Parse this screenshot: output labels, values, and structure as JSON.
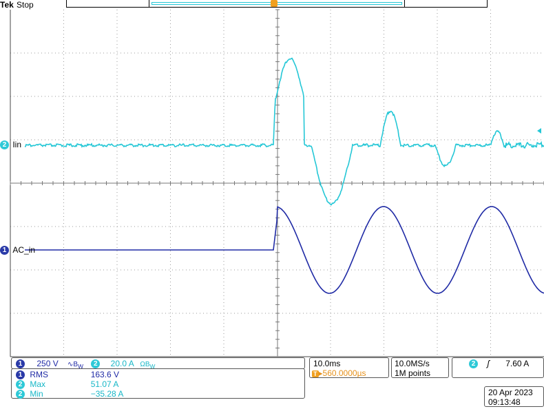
{
  "header": {
    "brand": "Tek",
    "status": "Stop"
  },
  "trigger_marker": "T",
  "channels": {
    "ch2": {
      "number": "2",
      "label": "Iin",
      "color": "#24c7d6"
    },
    "ch1": {
      "number": "1",
      "label": "AC_in",
      "color": "#1f2aa5"
    }
  },
  "scale_panel": {
    "ch1_scale": "250 V",
    "ch1_coupling_icon": "ac-coupling-bw-icon",
    "ch2_scale": "20.0 A",
    "ch2_coupling_icon": "dc-coupling-bw-icon"
  },
  "measurements": [
    {
      "channel": "1",
      "name": "RMS",
      "value": "163.6 V"
    },
    {
      "channel": "2",
      "name": "Max",
      "value": "51.07 A"
    },
    {
      "channel": "2",
      "name": "Min",
      "value": "−35.28 A"
    }
  ],
  "timebase": {
    "scale": "10.0ms",
    "delay": "▸560.0000µs"
  },
  "acquisition": {
    "sample_rate": "10.0MS/s",
    "record_length": "1M points"
  },
  "trigger": {
    "channel": "2",
    "slope_icon": "rising-edge-icon",
    "level": "7.60 A"
  },
  "datetime": {
    "date": "20 Apr 2023",
    "time": "09:13:48"
  }
}
